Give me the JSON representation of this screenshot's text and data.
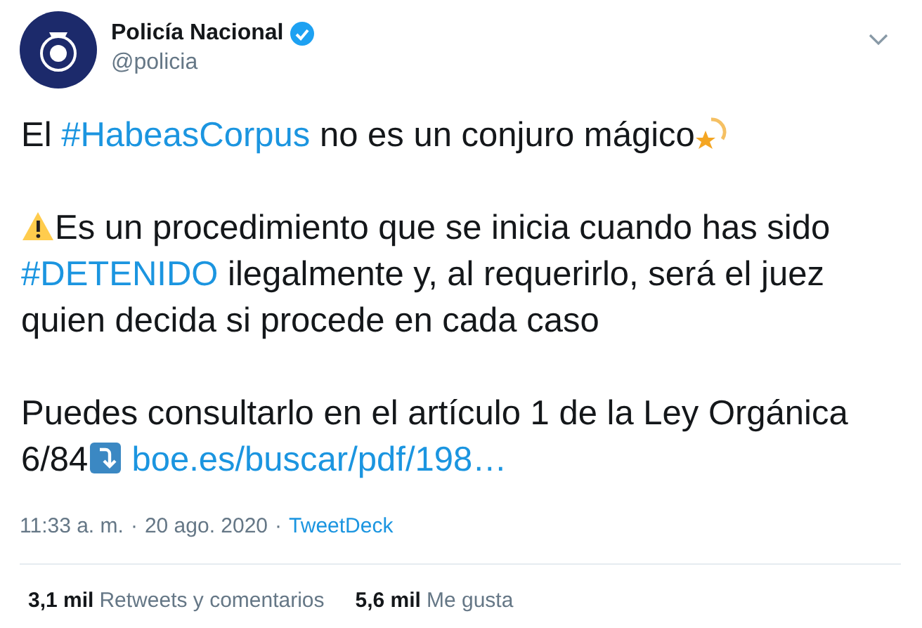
{
  "author": {
    "name": "Policía Nacional",
    "handle": "@policia",
    "verified": true
  },
  "body": [
    [
      {
        "kind": "text",
        "text": "El "
      },
      {
        "kind": "hashtag",
        "text": "#HabeasCorpus"
      },
      {
        "kind": "text",
        "text": " no es un conjuro mágico"
      },
      {
        "kind": "star-emoji"
      }
    ],
    [
      {
        "kind": "warning-emoji"
      },
      {
        "kind": "text",
        "text": "Es un procedimiento que se inicia cuando has sido "
      },
      {
        "kind": "hashtag",
        "text": "#DETENIDO"
      },
      {
        "kind": "text",
        "text": " ilegalmente y, al requerirlo, será el juez quien decida si procede en cada caso"
      }
    ],
    [
      {
        "kind": "text",
        "text": "Puedes consultarlo en el artículo 1 de la Ley Orgánica 6/84"
      },
      {
        "kind": "arrow-emoji"
      },
      {
        "kind": "link",
        "text": "boe.es/buscar/pdf/198…"
      }
    ]
  ],
  "meta": {
    "time": "11:33 a. m.",
    "separator_1": "·",
    "date": "20 ago. 2020",
    "separator_2": "·",
    "source": "TweetDeck"
  },
  "stats": [
    {
      "count": "3,1 mil",
      "label": "Retweets y comentarios"
    },
    {
      "count": "5,6 mil",
      "label": "Me gusta"
    }
  ]
}
